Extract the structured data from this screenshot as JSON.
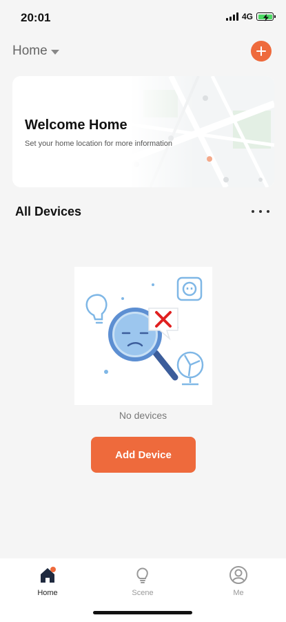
{
  "status_bar": {
    "time": "20:01",
    "network": "4G",
    "battery_charging": true
  },
  "header": {
    "home_label": "Home",
    "add_icon": "plus-icon"
  },
  "welcome_card": {
    "title": "Welcome Home",
    "subtitle": "Set your home location for more information"
  },
  "devices_section": {
    "title": "All Devices",
    "more_icon": "more-dots-icon",
    "empty_text": "No devices",
    "add_button_label": "Add Device"
  },
  "tab_bar": {
    "tabs": [
      {
        "label": "Home",
        "icon": "home-icon",
        "active": true
      },
      {
        "label": "Scene",
        "icon": "lightbulb-icon",
        "active": false
      },
      {
        "label": "Me",
        "icon": "user-icon",
        "active": false
      }
    ]
  },
  "colors": {
    "accent": "#ee6a3c",
    "background": "#f5f5f5",
    "illustration_blue": "#7fb7e6"
  }
}
